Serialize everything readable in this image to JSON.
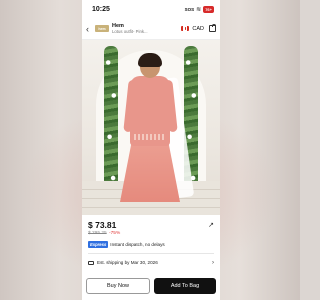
{
  "status_bar": {
    "time": "10:25",
    "sos": "SOS",
    "battery": "76+"
  },
  "header": {
    "logo": "hem",
    "brand": "Hem",
    "subtitle": "Lotus outfit- Pink...",
    "currency": "CAD"
  },
  "product": {
    "price": "$ 73.81",
    "original_price": "$ 295.25",
    "discount": "-75%",
    "express_badge": "Express",
    "express_text": "Instant dispatch, no delays",
    "shipping_text": "Est. shipping by Mar 30, 2026"
  },
  "actions": {
    "buy_now": "Buy Now",
    "add_to_bag": "Add To Bag"
  },
  "colors": {
    "express_blue": "#2f6fe0",
    "discount_red": "#e03a3a",
    "dress_pink": "#e8968b"
  }
}
